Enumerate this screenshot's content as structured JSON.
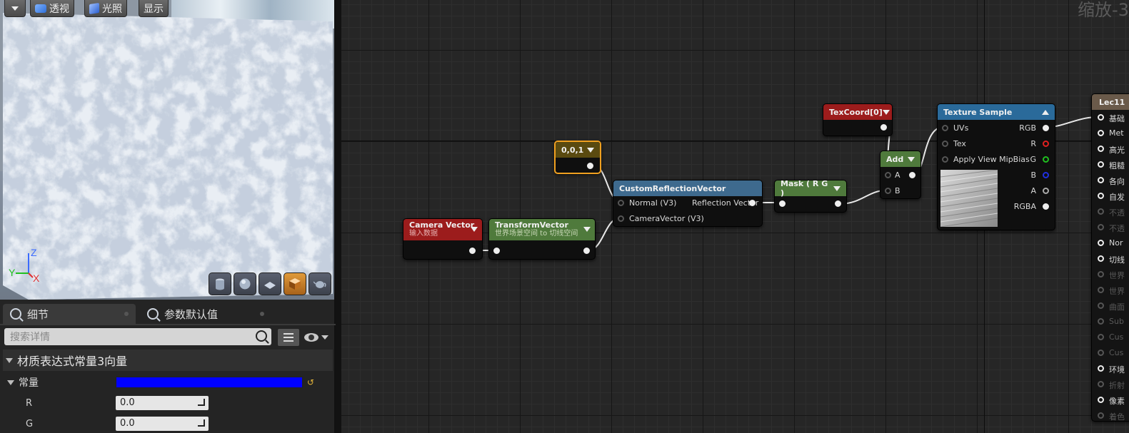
{
  "viewport": {
    "menu_label": "",
    "perspective_label": "透视",
    "lit_label": "光照",
    "show_label": "显示",
    "axis": {
      "z": "Z",
      "y": "Y",
      "x": "X"
    },
    "preview_shapes": [
      "cylinder-icon",
      "sphere-icon",
      "plane-icon",
      "cube-icon",
      "teapot-icon"
    ],
    "active_shape": "cube-icon"
  },
  "details": {
    "tabs": [
      {
        "label": "细节",
        "active": true
      },
      {
        "label": "参数默认值",
        "active": false
      }
    ],
    "search_placeholder": "搜索详情",
    "section_title": "材质表达式常量3向量",
    "constant_label": "常量",
    "constant_color": "#0000ff",
    "fields": [
      {
        "label": "R",
        "value": "0.0"
      },
      {
        "label": "G",
        "value": "0.0"
      }
    ]
  },
  "graph": {
    "zoom_label": "缩放-3",
    "nodes": {
      "const3": {
        "title": "0,0,1",
        "color": "#5a4a10",
        "selected_color": "#f0a020"
      },
      "camera_vector": {
        "title": "Camera Vector",
        "subtitle": "输入数据",
        "color": "#9c1c1c"
      },
      "transform_vector": {
        "title": "TransformVector",
        "subtitle": "世界场景空间 to 切线空间",
        "color": "#4f7a3c"
      },
      "custom_reflection": {
        "title": "CustomReflectionVector",
        "color": "#3e6a8e",
        "inputs": [
          "Normal (V3)",
          "CameraVector (V3)"
        ],
        "output": "Reflection Vector"
      },
      "mask": {
        "title": "Mask ( R G )",
        "color": "#4f7a3c"
      },
      "texcoord": {
        "title": "TexCoord[0]",
        "color": "#9c1c1c"
      },
      "add": {
        "title": "Add",
        "color": "#4f7a3c",
        "inputs": [
          "A",
          "B"
        ]
      },
      "texture_sample": {
        "title": "Texture Sample",
        "color": "#2a6a9a",
        "inputs": [
          "UVs",
          "Tex",
          "Apply View MipBias"
        ],
        "outputs": [
          "RGB",
          "R",
          "G",
          "B",
          "A",
          "RGBA"
        ]
      },
      "result": {
        "title": "Lec11",
        "color": "#6a5a4a",
        "pins": [
          "基础",
          "Met",
          "高光",
          "粗糙",
          "各向",
          "自发",
          "不透",
          "不透",
          "Nor",
          "切线",
          "世界",
          "世界",
          "曲面",
          "Sub",
          "Cus",
          "Cus",
          "环境",
          "折射",
          "像素",
          "着色"
        ]
      }
    }
  }
}
